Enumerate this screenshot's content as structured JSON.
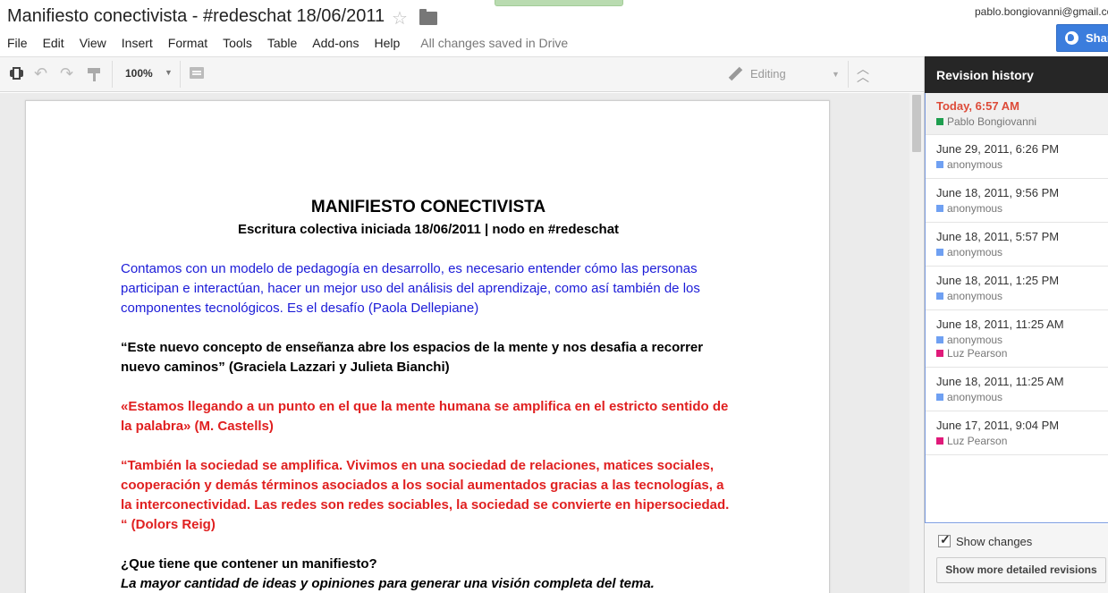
{
  "window": {
    "doc_title": "Manifiesto conectivista - #redeschat 18/06/2011",
    "user_email": "pablo.bongiovanni@gmail.com",
    "share_label": "Share"
  },
  "menu": {
    "items": [
      "File",
      "Edit",
      "View",
      "Insert",
      "Format",
      "Tools",
      "Table",
      "Add-ons",
      "Help"
    ],
    "save_status": "All changes saved in Drive"
  },
  "toolbar": {
    "zoom": "100%",
    "mode": "Editing"
  },
  "document": {
    "heading": "MANIFIESTO CONECTIVISTA",
    "subheading": "Escritura colectiva iniciada 18/06/2011 | nodo en #redeschat",
    "paragraphs": [
      "Contamos con un modelo de pedagogía en desarrollo, es necesario entender cómo las personas participan e interactúan, hacer un mejor uso del análisis del aprendizaje, como así también de los componentes tecnológicos. Es el desafío (Paola Dellepiane)",
      "“Este nuevo concepto de enseñanza abre los espacios de la mente y nos desafia a recorrer nuevo caminos” (Graciela Lazzari y Julieta Bianchi)",
      "«Estamos llegando a un punto en el que la mente humana se amplifica en el estricto sentido de la palabra» (M. Castells)",
      "“También la sociedad se amplifica. Vivimos en una sociedad de relaciones, matices sociales, cooperación y demás términos asociados a los social aumentados gracias a las tecnologías, a la interconectividad. Las redes son redes sociables, la sociedad se convierte en hipersociedad. “ (Dolors Reig)",
      "¿Que tiene que contener un manifiesto?",
      "La mayor cantidad de ideas y opiniones para generar una visión completa del tema."
    ]
  },
  "revisions": {
    "title": "Revision history",
    "items": [
      {
        "date": "Today, 6:57 AM",
        "authors": [
          "Pablo Bongiovanni"
        ],
        "colors": [
          "#1e9e4f"
        ]
      },
      {
        "date": "June 29, 2011, 6:26 PM",
        "authors": [
          "anonymous"
        ],
        "colors": [
          "#6fa0f2"
        ]
      },
      {
        "date": "June 18, 2011, 9:56 PM",
        "authors": [
          "anonymous"
        ],
        "colors": [
          "#6fa0f2"
        ]
      },
      {
        "date": "June 18, 2011, 5:57 PM",
        "authors": [
          "anonymous"
        ],
        "colors": [
          "#6fa0f2"
        ]
      },
      {
        "date": "June 18, 2011, 1:25 PM",
        "authors": [
          "anonymous"
        ],
        "colors": [
          "#6fa0f2"
        ]
      },
      {
        "date": "June 18, 2011, 11:25 AM",
        "authors": [
          "anonymous",
          "Luz Pearson"
        ],
        "colors": [
          "#6fa0f2",
          "#e01a7a"
        ]
      },
      {
        "date": "June 18, 2011, 11:25 AM",
        "authors": [
          "anonymous"
        ],
        "colors": [
          "#6fa0f2"
        ]
      },
      {
        "date": "June 17, 2011, 9:04 PM",
        "authors": [
          "Luz Pearson"
        ],
        "colors": [
          "#e01a7a"
        ]
      }
    ],
    "show_changes_label": "Show changes",
    "show_changes_checked": true,
    "detailed_button_label": "Show more detailed revisions"
  }
}
